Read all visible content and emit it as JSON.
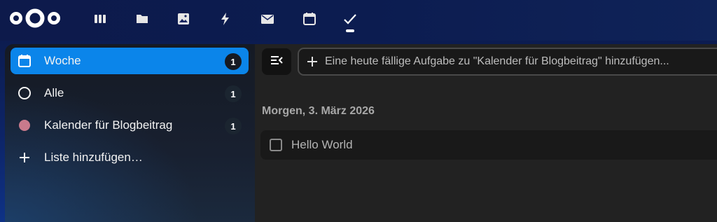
{
  "header": {
    "apps": [
      {
        "name": "dashboard-icon"
      },
      {
        "name": "files-icon"
      },
      {
        "name": "photos-icon"
      },
      {
        "name": "activity-icon"
      },
      {
        "name": "mail-icon"
      },
      {
        "name": "calendar-icon"
      },
      {
        "name": "tasks-icon"
      }
    ],
    "active_app": "tasks"
  },
  "sidebar": {
    "items": [
      {
        "label": "Woche",
        "count": "1",
        "icon": "calendar-week-icon"
      },
      {
        "label": "Alle",
        "count": "1",
        "icon": "circle-outline-icon"
      },
      {
        "label": "Kalender für Blogbeitrag",
        "count": "1",
        "icon": "color-dot-icon",
        "color": "#c97a8c"
      },
      {
        "label": "Liste hinzufügen…",
        "icon": "plus-icon"
      }
    ]
  },
  "main": {
    "add_task_placeholder": "Eine heute fällige Aufgabe zu \"Kalender für Blogbeitrag\" hinzufügen...",
    "section_heading": "Morgen, 3. März 2026",
    "tasks": [
      {
        "title": "Hello World",
        "done": false
      }
    ]
  },
  "colors": {
    "accent": "#0b85ea",
    "header_bg": "#0d1a4b",
    "list_color": "#c97a8c"
  }
}
